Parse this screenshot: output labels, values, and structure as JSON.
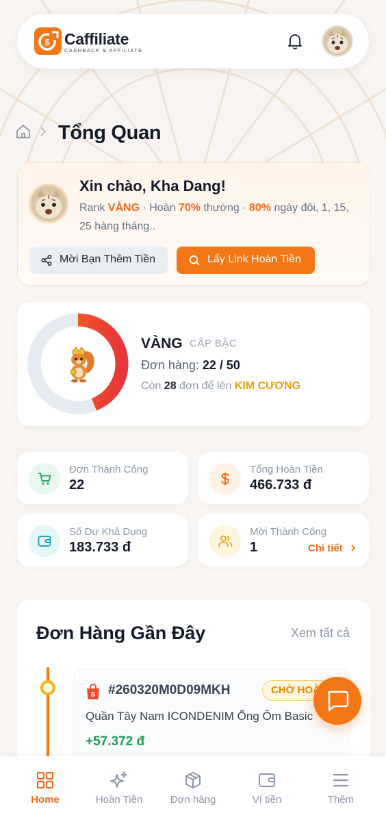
{
  "colors": {
    "accent": "#f47716",
    "brand_dark": "#1c2233",
    "success": "#1f9d55",
    "gold": "#e8a10b"
  },
  "header": {
    "logo_name": "Caffiliate",
    "logo_tagline": "CASHBACK & AFFILIATE",
    "bell_icon": "bell-icon",
    "avatar_icon": "user-avatar"
  },
  "breadcrumb": {
    "home_icon": "home-icon",
    "title": "Tổng Quan"
  },
  "welcome": {
    "greeting": "Xin chào, Kha Dang!",
    "rank_prefix": "Rank ",
    "rank": "VÀNG",
    "cashback_prefix": " · Hoàn ",
    "cashback_pct": "70%",
    "cashback_suffix": " thường · ",
    "double_pct": "80%",
    "double_suffix": " ngày đôi, 1, 15, 25 hàng tháng..",
    "invite_button": "Mời Bạn Thêm Tiền",
    "get_link_button": "Lấy Link Hoàn Tiền"
  },
  "rank_card": {
    "rank_name": "VÀNG",
    "rank_label": "CẤP BẬC",
    "orders_label": "Đơn hàng: ",
    "orders_value": "22 / 50",
    "orders_done": 22,
    "orders_target": 50,
    "remain_prefix": "Còn ",
    "remain_count": "28",
    "remain_mid": " đơn để lên ",
    "next_rank": "KIM CƯƠNG"
  },
  "stats": [
    {
      "label": "Đơn Thành Công",
      "value": "22",
      "icon": "cart-icon"
    },
    {
      "label": "Tổng Hoàn Tiền",
      "value": "466.733 đ",
      "icon": "dollar-icon"
    },
    {
      "label": "Số Dư Khả Dụng",
      "value": "183.733 đ",
      "icon": "wallet-icon"
    },
    {
      "label": "Mời Thành Công",
      "value": "1",
      "icon": "users-icon",
      "detail": "Chi tiết"
    }
  ],
  "recent_orders": {
    "title": "Đơn Hàng Gần Đây",
    "see_all": "Xem tất cả",
    "items": [
      {
        "id": "#260320M0D09MKH",
        "status": "CHỜ HOÀN",
        "product": "Quần Tây Nam ICONDENIM Ống Ôm Basic",
        "cashback": "+57.372 đ",
        "shop_icon": "shopee-bag-icon"
      }
    ]
  },
  "fab": {
    "icon": "chat-icon"
  },
  "bottom_nav": [
    {
      "label": "Home",
      "icon": "grid-icon",
      "active": true
    },
    {
      "label": "Hoàn Tiền",
      "icon": "sparkle-icon",
      "active": false
    },
    {
      "label": "Đơn hàng",
      "icon": "box-icon",
      "active": false
    },
    {
      "label": "Ví tiền",
      "icon": "wallet-icon",
      "active": false
    },
    {
      "label": "Thêm",
      "icon": "menu-icon",
      "active": false
    }
  ]
}
